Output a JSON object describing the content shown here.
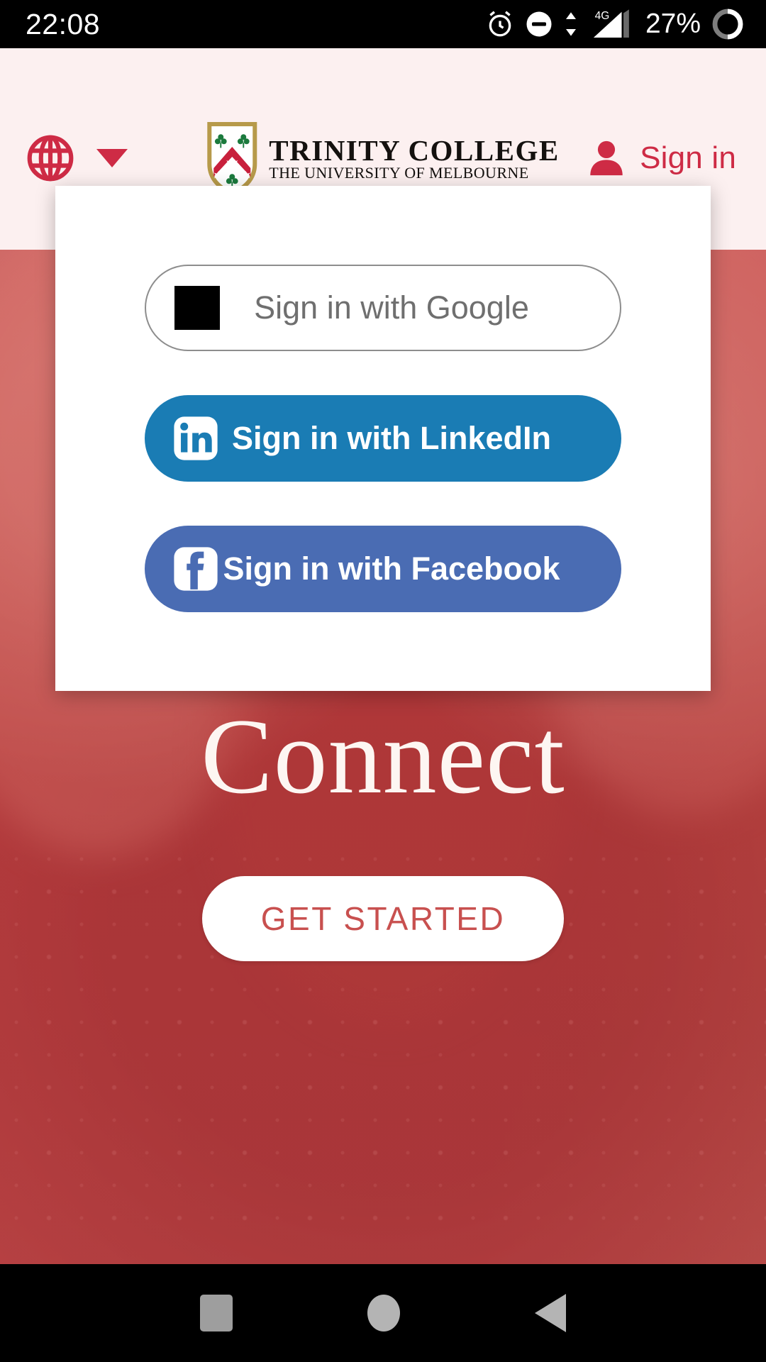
{
  "status_bar": {
    "clock": "22:08",
    "battery_percent": "27%",
    "network_label": "4G",
    "icons": [
      "alarm-icon",
      "do-not-disturb-icon",
      "data-transfer-icon",
      "signal-4g-icon",
      "battery-ring-icon"
    ]
  },
  "header": {
    "language_icon": "globe-icon",
    "language_caret": "chevron-down-icon",
    "brand_name": "TRINITY COLLEGE",
    "brand_sub": "THE UNIVERSITY OF MELBOURNE",
    "crest_icon": "trinity-crest-icon",
    "signin_icon": "person-icon",
    "signin_label": "Sign in",
    "accent_color": "#ce2b45",
    "background_color": "#fcf0f0"
  },
  "signin_modal": {
    "buttons": [
      {
        "label": "Sign in with Google",
        "provider": "google",
        "icon": "broken-image-placeholder-icon",
        "background": "#ffffff",
        "text_color": "#6f6f6f",
        "border_color": "#8d8d8d"
      },
      {
        "label": "Sign in with LinkedIn",
        "provider": "linkedin",
        "icon": "linkedin-icon",
        "background": "#1a7cb4",
        "text_color": "#ffffff",
        "border_color": "transparent"
      },
      {
        "label": "Sign in with Facebook",
        "provider": "facebook",
        "icon": "facebook-icon",
        "background": "#4a6cb3",
        "text_color": "#ffffff",
        "border_color": "transparent"
      }
    ]
  },
  "hero": {
    "title": "Connect",
    "cta_label": "GET STARTED",
    "cta_text_color": "#c8504f",
    "overlay_color": "#b94c48"
  },
  "nav_bar": {
    "items": [
      {
        "name": "recents",
        "icon": "square-icon"
      },
      {
        "name": "home",
        "icon": "circle-icon"
      },
      {
        "name": "back",
        "icon": "triangle-left-icon"
      }
    ]
  }
}
